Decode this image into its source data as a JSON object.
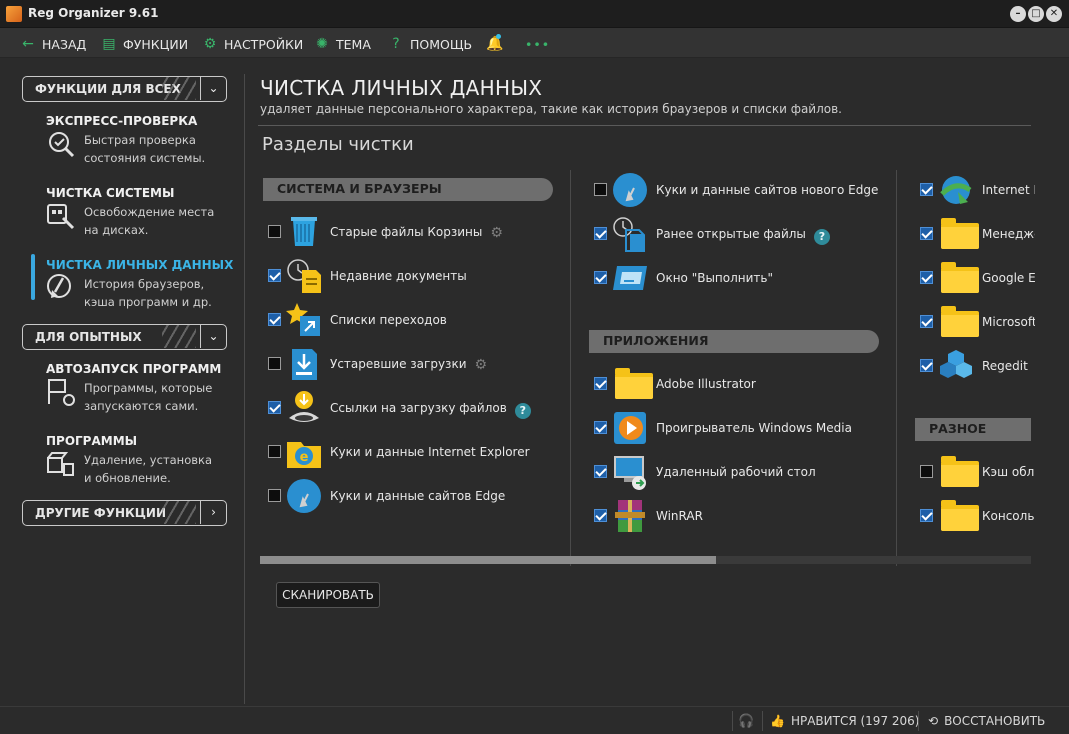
{
  "window": {
    "title": "Reg Organizer 9.61"
  },
  "toolbar": {
    "back": "НАЗАД",
    "functions": "ФУНКЦИИ",
    "settings": "НАСТРОЙКИ",
    "theme": "ТЕМА",
    "help": "ПОМОЩЬ",
    "more": "•••"
  },
  "sidebar": {
    "group_all": "ФУНКЦИИ ДЛЯ ВСЕХ",
    "group_advanced": "ДЛЯ ОПЫТНЫХ",
    "group_other": "ДРУГИЕ ФУНКЦИИ",
    "items": [
      {
        "title": "ЭКСПРЕСС-ПРОВЕРКА",
        "line1": "Быстрая проверка",
        "line2": "состояния системы."
      },
      {
        "title": "ЧИСТКА СИСТЕМЫ",
        "line1": "Освобождение места",
        "line2": "на дисках."
      },
      {
        "title": "ЧИСТКА ЛИЧНЫХ ДАННЫХ",
        "line1": "История браузеров,",
        "line2": "кэша программ и др."
      },
      {
        "title": "АВТОЗАПУСК ПРОГРАММ",
        "line1": "Программы, которые",
        "line2": "запускаются сами."
      },
      {
        "title": "ПРОГРАММЫ",
        "line1": "Удаление, установка",
        "line2": "и обновление."
      }
    ]
  },
  "main": {
    "title": "ЧИСТКА ЛИЧНЫХ ДАННЫХ",
    "subtitle": "удаляет данные персонального характера, такие как история браузеров и списки файлов.",
    "sections_title": "Разделы чистки",
    "scan_button": "СКАНИРОВАТЬ",
    "col1": {
      "header": "СИСТЕМА И БРАУЗЕРЫ",
      "items": [
        {
          "label": "Старые файлы Корзины",
          "checked": false,
          "icon": "recycle-bin-icon"
        },
        {
          "label": "Недавние документы",
          "checked": true,
          "icon": "recent-documents-icon"
        },
        {
          "label": "Списки переходов",
          "checked": true,
          "icon": "jump-lists-icon"
        },
        {
          "label": "Устаревшие загрузки",
          "checked": false,
          "icon": "downloads-icon"
        },
        {
          "label": "Ссылки на загрузку файлов",
          "checked": true,
          "icon": "download-links-icon"
        },
        {
          "label": "Куки и данные Internet Explorer",
          "checked": false,
          "icon": "internet-explorer-icon"
        },
        {
          "label": "Куки и данные сайтов Edge",
          "checked": false,
          "icon": "edge-icon"
        }
      ]
    },
    "col2": {
      "items_top": [
        {
          "label": "Куки и данные сайтов нового Edge",
          "checked": false,
          "icon": "new-edge-icon"
        },
        {
          "label": "Ранее открытые файлы",
          "checked": true,
          "icon": "opened-files-icon"
        },
        {
          "label": "Окно \"Выполнить\"",
          "checked": true,
          "icon": "run-dialog-icon"
        }
      ],
      "header": "ПРИЛОЖЕНИЯ",
      "items": [
        {
          "label": "Adobe Illustrator",
          "checked": true,
          "icon": "folder-icon"
        },
        {
          "label": "Проигрыватель Windows Media",
          "checked": true,
          "icon": "windows-media-player-icon"
        },
        {
          "label": "Удаленный рабочий стол",
          "checked": true,
          "icon": "remote-desktop-icon"
        },
        {
          "label": "WinRAR",
          "checked": true,
          "icon": "winrar-icon"
        }
      ]
    },
    "col3": {
      "items_top": [
        {
          "label": "Internet D",
          "checked": true,
          "icon": "internet-download-manager-icon"
        },
        {
          "label": "Менедже",
          "checked": true,
          "icon": "folder-icon"
        },
        {
          "label": "Google Ea",
          "checked": true,
          "icon": "folder-icon"
        },
        {
          "label": "Microsoft",
          "checked": true,
          "icon": "folder-icon"
        },
        {
          "label": "Regedit",
          "checked": true,
          "icon": "regedit-icon"
        }
      ],
      "header": "РАЗНОЕ",
      "items": [
        {
          "label": "Кэш обла",
          "checked": false,
          "icon": "folder-icon"
        },
        {
          "label": "Консоль :",
          "checked": true,
          "icon": "folder-icon"
        }
      ]
    }
  },
  "status": {
    "likes": "НРАВИТСЯ (197 206)",
    "restore": "ВОССТАНОВИТЬ"
  },
  "colors": {
    "background": "#2b2b2b",
    "accent_blue": "#3bb4e6",
    "accent_green": "#39b46a",
    "checkbox_checked": "#1e5fa8",
    "section_header": "#6e6e6e"
  }
}
